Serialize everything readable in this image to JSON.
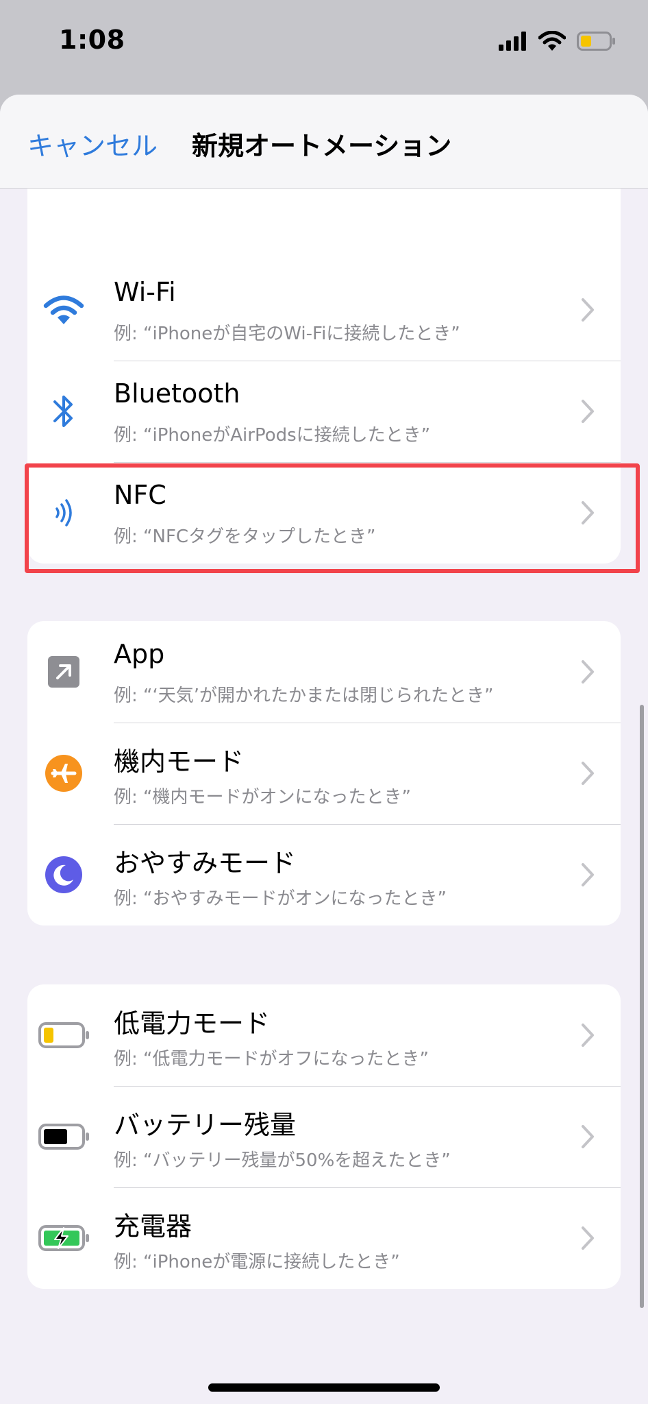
{
  "status_bar": {
    "time": "1:08"
  },
  "nav": {
    "cancel_label": "キャンセル",
    "title": "新規オートメーション"
  },
  "groups": [
    {
      "items": [
        {
          "icon": "wifi-icon",
          "title": "Wi-Fi",
          "subtitle": "例: “iPhoneが自宅のWi-Fiに接続したとき”"
        },
        {
          "icon": "bluetooth-icon",
          "title": "Bluetooth",
          "subtitle": "例: “iPhoneがAirPodsに接続したとき”"
        },
        {
          "icon": "nfc-icon",
          "title": "NFC",
          "subtitle": "例: “NFCタグをタップしたとき”",
          "highlighted": true
        }
      ]
    },
    {
      "items": [
        {
          "icon": "app-icon",
          "title": "App",
          "subtitle": "例: “‘天気’が開かれたかまたは閉じられたとき”"
        },
        {
          "icon": "airplane-icon",
          "title": "機内モード",
          "subtitle": "例: “機内モードがオンになったとき”"
        },
        {
          "icon": "moon-icon",
          "title": "おやすみモード",
          "subtitle": "例: “おやすみモードがオンになったとき”"
        }
      ]
    },
    {
      "items": [
        {
          "icon": "low-battery-icon",
          "title": "低電力モード",
          "subtitle": "例: “低電力モードがオフになったとき”"
        },
        {
          "icon": "battery-icon",
          "title": "バッテリー残量",
          "subtitle": "例: “バッテリー残量が50%を超えたとき”"
        },
        {
          "icon": "charging-battery-icon",
          "title": "充電器",
          "subtitle": "例: “iPhoneが電源に接続したとき”"
        }
      ]
    }
  ],
  "colors": {
    "accent": "#2f7bdc",
    "highlight": "#f2434b",
    "airplane": "#f7931e",
    "moon": "#5e5ce6",
    "app": "#8e8e93",
    "battery_low": "#f5c400",
    "battery_charge": "#34c759"
  }
}
